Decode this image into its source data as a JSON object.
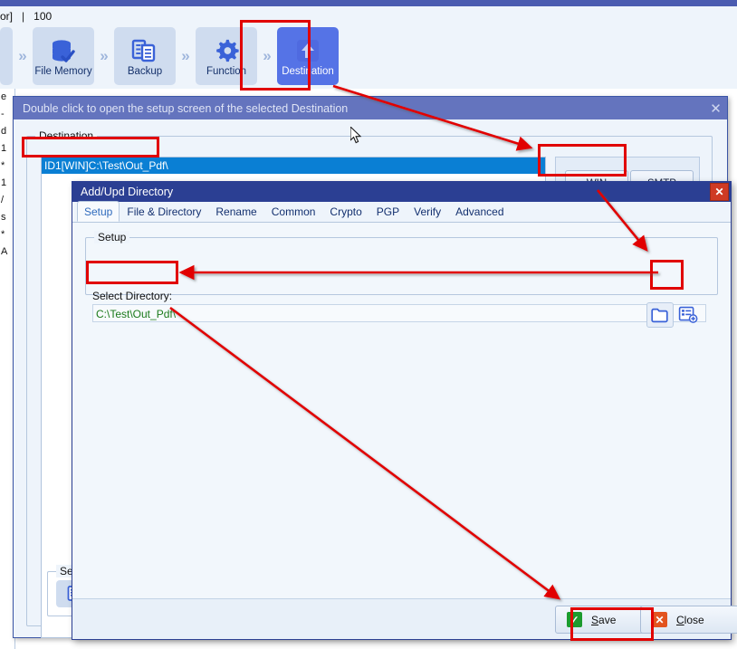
{
  "status_bar": {
    "left_fragment": "or]",
    "separator": "|",
    "value": "100"
  },
  "toolbar": {
    "items": [
      {
        "label": "File Memory",
        "icon": "database-check-icon",
        "selected": false
      },
      {
        "label": "Backup",
        "icon": "documents-copy-icon",
        "selected": false
      },
      {
        "label": "Function",
        "icon": "gear-icon",
        "selected": false
      },
      {
        "label": "Destination",
        "icon": "upload-arrow-icon",
        "selected": true
      }
    ],
    "chevron": "»"
  },
  "behind_left_fragments": [
    "e",
    "-",
    "d",
    "1",
    "*",
    "1",
    "/",
    "s",
    "*",
    "A"
  ],
  "destination_window": {
    "title": "Double click to open the setup screen of the selected Destination",
    "close_icon": "close-icon",
    "group_legend": "Destination",
    "selected_entry": "ID1[WIN]C:\\Test\\Out_Pdf\\",
    "protocol_buttons": [
      "WIN",
      "SMTP"
    ]
  },
  "setup_mini": {
    "legend": "Setup",
    "icon": "edit-document-icon"
  },
  "add_upd_dialog": {
    "title": "Add/Upd Directory",
    "close_label": "✕",
    "tabs": [
      {
        "label": "Setup",
        "active": true
      },
      {
        "label": "File & Directory",
        "active": false
      },
      {
        "label": "Rename",
        "active": false
      },
      {
        "label": "Common",
        "active": false
      },
      {
        "label": "Crypto",
        "active": false
      },
      {
        "label": "PGP",
        "active": false
      },
      {
        "label": "Verify",
        "active": false
      },
      {
        "label": "Advanced",
        "active": false
      }
    ],
    "setup_group_legend": "Setup",
    "select_directory_label": "Select Directory:",
    "directory_value": "C:\\Test\\Out_Pdf\\",
    "directory_placeholder": "Select Directory",
    "browse_icon": "folder-icon",
    "list_add_icon": "list-add-icon",
    "buttons": {
      "save": {
        "label_pre": "",
        "label_accel": "S",
        "label_post": "ave",
        "icon": "checkmark-icon"
      },
      "close": {
        "label_pre": "",
        "label_accel": "C",
        "label_post": "lose",
        "icon": "cross-icon"
      }
    }
  },
  "colors": {
    "annotation_red": "#e10000",
    "accent_blue": "#2b3f93",
    "selection_blue": "#0a7fd4",
    "directory_green": "#1b7a1b",
    "save_green": "#1d9b2e",
    "close_orange": "#e2541f"
  }
}
